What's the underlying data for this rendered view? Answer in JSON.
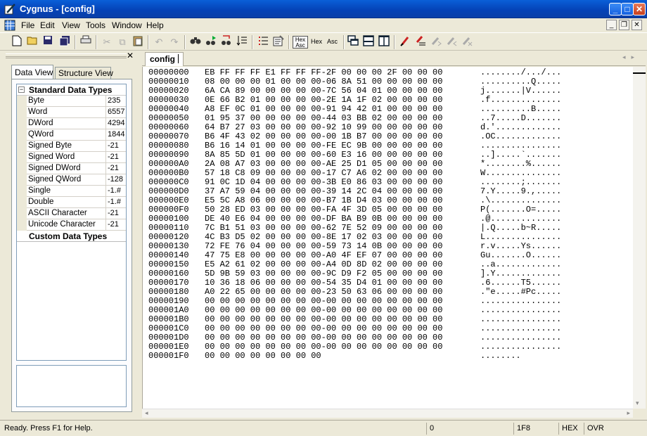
{
  "window": {
    "title": "Cygnus - [config]",
    "controls": {
      "minimize": "_",
      "maximize": "□",
      "close": "✕"
    },
    "mdi_controls": {
      "minimize": "_",
      "restore": "❐",
      "close": "✕"
    }
  },
  "menu": [
    "File",
    "Edit",
    "View",
    "Tools",
    "Window",
    "Help"
  ],
  "toolbar": {
    "hex_asc_label_top": "Hex",
    "hex_asc_label_bottom": "Asc",
    "hex_label": "Hex",
    "asc_label": "Asc"
  },
  "left_panel": {
    "close": "✕",
    "tabs": [
      "Data View",
      "Structure View"
    ],
    "active_tab": "Data View",
    "standard_header": "Standard Data Types",
    "custom_header": "Custom Data Types",
    "rows": [
      {
        "name": "Byte",
        "value": "235"
      },
      {
        "name": "Word",
        "value": "6557"
      },
      {
        "name": "DWord",
        "value": "4294"
      },
      {
        "name": "QWord",
        "value": "1844"
      },
      {
        "name": "Signed Byte",
        "value": "-21"
      },
      {
        "name": "Signed Word",
        "value": "-21"
      },
      {
        "name": "Signed DWord",
        "value": "-21"
      },
      {
        "name": "Signed QWord",
        "value": "-128"
      },
      {
        "name": "Single",
        "value": "-1.#"
      },
      {
        "name": "Double",
        "value": "-1.#"
      },
      {
        "name": "ASCII Character",
        "value": "-21"
      },
      {
        "name": "Unicode Character",
        "value": "-21"
      }
    ]
  },
  "document": {
    "tab": "config",
    "lines": [
      {
        "offset": "00000000",
        "hex": "EB FF FF FF E1 FF FF FF-2F 00 00 00 2F 00 00 00",
        "ascii": "......../.../..."
      },
      {
        "offset": "00000010",
        "hex": "08 00 00 00 01 00 00 00-06 8A 51 00 00 00 00 00",
        "ascii": "..........Q....."
      },
      {
        "offset": "00000020",
        "hex": "6A CA 89 00 00 00 00 00-7C 56 04 01 00 00 00 00",
        "ascii": "j.......|V......"
      },
      {
        "offset": "00000030",
        "hex": "0E 66 B2 01 00 00 00 00-2E 1A 1F 02 00 00 00 00",
        "ascii": ".f.............."
      },
      {
        "offset": "00000040",
        "hex": "A8 EF 0C 01 00 00 00 00-91 94 42 01 00 00 00 00",
        "ascii": "..........B....."
      },
      {
        "offset": "00000050",
        "hex": "01 95 37 00 00 00 00 00-44 03 BB 02 00 00 00 00",
        "ascii": "..7.....D......."
      },
      {
        "offset": "00000060",
        "hex": "64 B7 27 03 00 00 00 00-92 10 99 00 00 00 00 00",
        "ascii": "d.'............."
      },
      {
        "offset": "00000070",
        "hex": "B6 4F 43 02 00 00 00 00-00 1B B7 00 00 00 00 00",
        "ascii": ".OC............."
      },
      {
        "offset": "00000080",
        "hex": "B6 16 14 01 00 00 00 00-FE EC 9B 00 00 00 00 00",
        "ascii": "................"
      },
      {
        "offset": "00000090",
        "hex": "8A 85 5D 01 00 00 00 00-60 E3 16 00 00 00 00 00",
        "ascii": "..].....`......."
      },
      {
        "offset": "000000A0",
        "hex": "2A 08 A7 03 00 00 00 00-AE 25 D1 05 00 00 00 00",
        "ascii": "*........%......"
      },
      {
        "offset": "000000B0",
        "hex": "57 18 C8 09 00 00 00 00-17 C7 A6 02 00 00 00 00",
        "ascii": "W..............."
      },
      {
        "offset": "000000C0",
        "hex": "91 0C 1D 04 00 00 00 00-3B E0 86 03 00 00 00 00",
        "ascii": "........;......."
      },
      {
        "offset": "000000D0",
        "hex": "37 A7 59 04 00 00 00 00-39 14 2C 04 00 00 00 00",
        "ascii": "7.Y.....9.,....."
      },
      {
        "offset": "000000E0",
        "hex": "E5 5C A8 06 00 00 00 00-B7 1B D4 03 00 00 00 00",
        "ascii": ".\\.............."
      },
      {
        "offset": "000000F0",
        "hex": "50 28 ED 03 00 00 00 00-FA 4F 3D 05 00 00 00 00",
        "ascii": "P(.......O=....."
      },
      {
        "offset": "00000100",
        "hex": "DE 40 E6 04 00 00 00 00-DF BA B9 0B 00 00 00 00",
        "ascii": ".@.............."
      },
      {
        "offset": "00000110",
        "hex": "7C B1 51 03 00 00 00 00-62 7E 52 09 00 00 00 00",
        "ascii": "|.Q.....b~R....."
      },
      {
        "offset": "00000120",
        "hex": "4C B3 D5 02 00 00 00 00-8E 17 02 03 00 00 00 00",
        "ascii": "L..............."
      },
      {
        "offset": "00000130",
        "hex": "72 FE 76 04 00 00 00 00-59 73 14 0B 00 00 00 00",
        "ascii": "r.v.....Ys......"
      },
      {
        "offset": "00000140",
        "hex": "47 75 E8 00 00 00 00 00-A0 4F EF 07 00 00 00 00",
        "ascii": "Gu.......O......"
      },
      {
        "offset": "00000150",
        "hex": "E5 A2 61 02 00 00 00 00-A4 0D 8D 02 00 00 00 00",
        "ascii": "..a............."
      },
      {
        "offset": "00000160",
        "hex": "5D 9B 59 03 00 00 00 00-9C D9 F2 05 00 00 00 00",
        "ascii": "].Y............."
      },
      {
        "offset": "00000170",
        "hex": "10 36 18 06 00 00 00 00-54 35 D4 01 00 00 00 00",
        "ascii": ".6......T5......"
      },
      {
        "offset": "00000180",
        "hex": "A0 22 65 00 00 00 00 00-23 50 63 06 00 00 00 00",
        "ascii": ".\"e.....#Pc....."
      },
      {
        "offset": "00000190",
        "hex": "00 00 00 00 00 00 00 00-00 00 00 00 00 00 00 00",
        "ascii": "................"
      },
      {
        "offset": "000001A0",
        "hex": "00 00 00 00 00 00 00 00-00 00 00 00 00 00 00 00",
        "ascii": "................"
      },
      {
        "offset": "000001B0",
        "hex": "00 00 00 00 00 00 00 00-00 00 00 00 00 00 00 00",
        "ascii": "................"
      },
      {
        "offset": "000001C0",
        "hex": "00 00 00 00 00 00 00 00-00 00 00 00 00 00 00 00",
        "ascii": "................"
      },
      {
        "offset": "000001D0",
        "hex": "00 00 00 00 00 00 00 00-00 00 00 00 00 00 00 00",
        "ascii": "................"
      },
      {
        "offset": "000001E0",
        "hex": "00 00 00 00 00 00 00 00-00 00 00 00 00 00 00 00",
        "ascii": "................"
      },
      {
        "offset": "000001F0",
        "hex": "00 00 00 00 00 00 00 00",
        "ascii": "........"
      }
    ]
  },
  "status": {
    "message": "Ready.  Press F1 for Help.",
    "position": "0",
    "size": "1F8",
    "mode": "HEX",
    "insert_mode": "OVR"
  },
  "colors": {
    "titlebar": "#0543b8",
    "chrome": "#ece9d8"
  }
}
